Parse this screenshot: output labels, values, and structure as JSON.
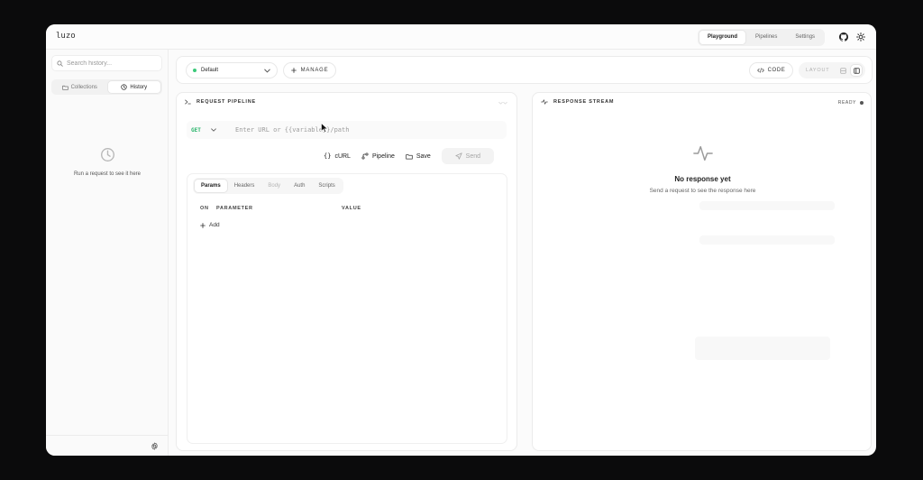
{
  "brand": "luzo",
  "nav": [
    {
      "label": "Playground",
      "active": true
    },
    {
      "label": "Pipelines",
      "active": false
    },
    {
      "label": "Settings",
      "active": false
    }
  ],
  "top_icons": [
    "github-icon",
    "sun-icon"
  ],
  "sidebar": {
    "search_placeholder": "Search history...",
    "tabs": [
      {
        "label": "Collections",
        "icon": "folder-icon",
        "active": false
      },
      {
        "label": "History",
        "icon": "clock-icon",
        "active": true
      }
    ],
    "empty_message": "Run a request to see it here"
  },
  "toolbar": {
    "environment": "Default",
    "manage_label": "MANAGE",
    "code_label": "CODE",
    "layout_label": "LAYOUT"
  },
  "request": {
    "title": "REQUEST PIPELINE",
    "method": "GET",
    "url_placeholder": "Enter URL or {{variable}}/path",
    "actions": {
      "curl": "cURL",
      "pipeline": "Pipeline",
      "save": "Save",
      "send": "Send"
    },
    "tabs": [
      {
        "label": "Params",
        "state": "active"
      },
      {
        "label": "Headers",
        "state": "normal"
      },
      {
        "label": "Body",
        "state": "dim"
      },
      {
        "label": "Auth",
        "state": "normal"
      },
      {
        "label": "Scripts",
        "state": "normal"
      }
    ],
    "columns": {
      "on": "ON",
      "parameter": "PARAMETER",
      "value": "VALUE"
    },
    "add_label": "Add"
  },
  "response": {
    "title": "RESPONSE STREAM",
    "status": "READY",
    "empty_title": "No response yet",
    "empty_subtitle": "Send a request to see the response here"
  },
  "colors": {
    "method_get": "#28b46a",
    "env_dot": "#3cc97a",
    "background": "#0b0b0c"
  }
}
